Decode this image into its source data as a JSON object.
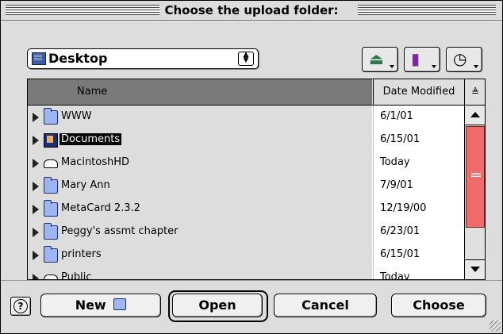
{
  "dialog": {
    "title": "Choose the upload folder:"
  },
  "location": {
    "selected": "Desktop",
    "icon": "desktop-icon"
  },
  "toolbar": {
    "shortcuts_icon": "network-globe-icon",
    "favorites_icon": "favorites-book-icon",
    "recent_icon": "recent-clock-icon"
  },
  "list": {
    "columns": {
      "name": "Name",
      "date": "Date Modified",
      "sort_icon": "sort-order-icon"
    },
    "rows": [
      {
        "name": "WWW",
        "date": "6/1/01",
        "icon": "folder-icon"
      },
      {
        "name": "Documents",
        "date": "6/15/01",
        "icon": "documents-folder-icon",
        "selected": true
      },
      {
        "name": "MacintoshHD",
        "date": "Today",
        "icon": "hard-disk-icon"
      },
      {
        "name": "Mary Ann",
        "date": "7/9/01",
        "icon": "folder-icon"
      },
      {
        "name": "MetaCard 2.3.2",
        "date": "12/19/00",
        "icon": "folder-icon"
      },
      {
        "name": "Peggy's assmt chapter",
        "date": "6/23/01",
        "icon": "folder-icon"
      },
      {
        "name": "printers",
        "date": "6/15/01",
        "icon": "folder-icon"
      },
      {
        "name": "Public",
        "date": "Today",
        "icon": "hard-disk-icon"
      }
    ]
  },
  "buttons": {
    "help": "?",
    "new": "New",
    "open": "Open",
    "cancel": "Cancel",
    "choose": "Choose"
  },
  "colors": {
    "scroll_thumb": "#ef6a6a",
    "header_sorted": "#7a7a7a"
  }
}
